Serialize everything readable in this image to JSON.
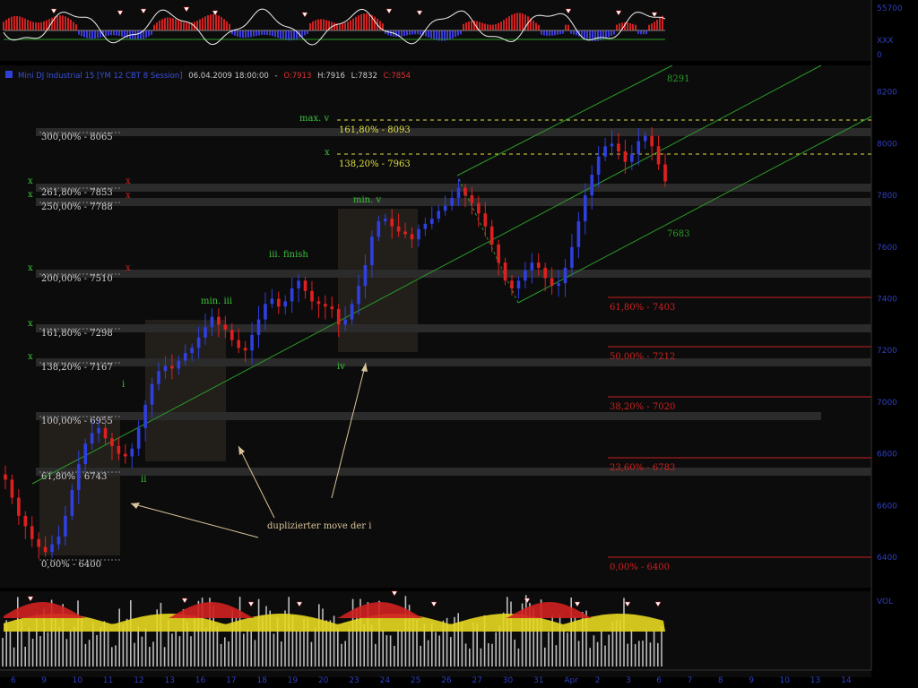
{
  "header": {
    "instrument": "Mini DJ Industrial 15 [YM 12 CBT  8 Session]",
    "datetime": "06.04.2009 18:00:00",
    "sep": "-",
    "open": "O:7913",
    "high": "H:7916",
    "low": "L:7832",
    "close": "C:7854",
    "icon": "series-square-icon",
    "colors": {
      "instrument": "#3b4fd8",
      "open": "#e03030",
      "close": "#e03030",
      "hl": "#c8c8c8"
    }
  },
  "top_panel": {
    "axis_labels": [
      "55700",
      "0"
    ]
  },
  "bottom_panel": {
    "axis_labels": [
      "VOL"
    ]
  },
  "chart_data": {
    "type": "candlestick",
    "y_axis_labels": [
      "XXX",
      "8200",
      "8000",
      "7800",
      "7600",
      "7400",
      "7200",
      "7000",
      "6800",
      "6600",
      "6400"
    ],
    "x_axis_labels": [
      "6",
      "9",
      "10",
      "11",
      "12",
      "13",
      "16",
      "17",
      "18",
      "19",
      "20",
      "23",
      "24",
      "25",
      "26",
      "27",
      "30",
      "31",
      "Apr",
      "2",
      "3",
      "6",
      "7",
      "8",
      "9",
      "10",
      "13",
      "14"
    ],
    "fib_left": [
      {
        "label": "300,00% - 8065",
        "value": 8065
      },
      {
        "label": "261,80% - 7853",
        "value": 7853
      },
      {
        "label": "250,00% - 7788",
        "value": 7788
      },
      {
        "label": "200,00% - 7510",
        "value": 7510
      },
      {
        "label": "161,80% - 7298",
        "value": 7298
      },
      {
        "label": "138,20% - 7167",
        "value": 7167
      },
      {
        "label": "100,00% - 6955",
        "value": 6955
      },
      {
        "label": "61,80% - 6743",
        "value": 6743
      },
      {
        "label": "0,00% - 6400",
        "value": 6400
      }
    ],
    "fib_right": [
      {
        "label": "61,80% - 7403",
        "value": 7403
      },
      {
        "label": "50,00% - 7212",
        "value": 7212
      },
      {
        "label": "38,20% - 7020",
        "value": 7020
      },
      {
        "label": "23,60% - 6783",
        "value": 6783
      },
      {
        "label": "0,00% - 6400",
        "value": 6400
      }
    ],
    "fib_top": [
      {
        "label": "161,80% - 8093",
        "value": 8093
      },
      {
        "label": "138,20% - 7963",
        "value": 7963
      }
    ],
    "channel_labels": [
      "8291",
      "7683"
    ],
    "wave_labels": [
      "i",
      "ii",
      "min. iii",
      "iii. finish",
      "iv",
      "min. v",
      "max. v"
    ],
    "markers": [
      "x",
      "x",
      "x",
      "x",
      "x",
      "x",
      "x",
      "x",
      "x"
    ],
    "annotation": "duplizierter move der i",
    "series": [
      {
        "name": "price",
        "values": [
          6700,
          6630,
          6560,
          6520,
          6470,
          6440,
          6420,
          6450,
          6480,
          6560,
          6660,
          6760,
          6840,
          6880,
          6900,
          6860,
          6830,
          6800,
          6790,
          6820,
          6900,
          6990,
          7070,
          7120,
          7140,
          7130,
          7160,
          7190,
          7210,
          7250,
          7290,
          7330,
          7300,
          7280,
          7240,
          7210,
          7200,
          7260,
          7320,
          7380,
          7400,
          7370,
          7390,
          7440,
          7470,
          7430,
          7390,
          7380,
          7370,
          7360,
          7300,
          7320,
          7380,
          7450,
          7530,
          7640,
          7700,
          7710,
          7680,
          7660,
          7650,
          7630,
          7670,
          7690,
          7710,
          7740,
          7760,
          7790,
          7830,
          7800,
          7770,
          7730,
          7680,
          7610,
          7540,
          7470,
          7440,
          7470,
          7510,
          7540,
          7520,
          7480,
          7450,
          7460,
          7520,
          7600,
          7700,
          7800,
          7880,
          7950,
          7990,
          8000,
          7970,
          7930,
          7960,
          8010,
          8030,
          7990,
          7920,
          7854
        ]
      }
    ]
  }
}
